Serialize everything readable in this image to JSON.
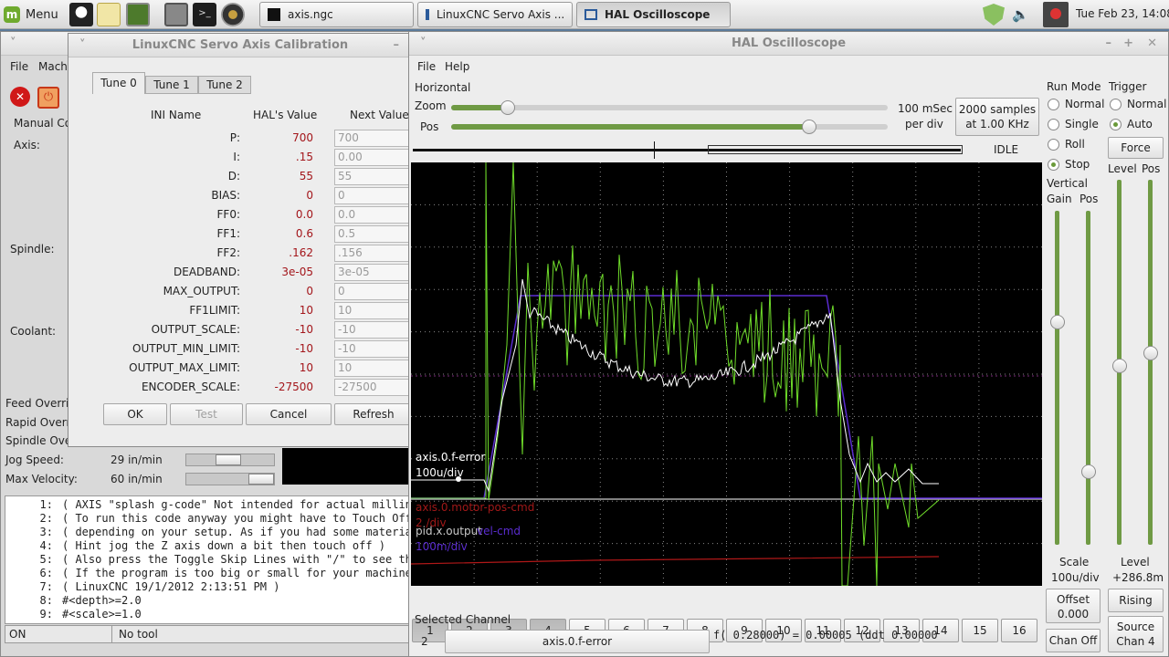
{
  "taskbar": {
    "menu_label": "Menu",
    "tasks": [
      "axis.ngc",
      "LinuxCNC Servo Axis ...",
      "HAL Oscilloscope"
    ],
    "clock": "Tue Feb 23, 14:08"
  },
  "axis": {
    "menu": [
      "File",
      "Mach"
    ],
    "tab_manual": "Manual Co",
    "axis_label": "Axis:",
    "spindle_label": "Spindle:",
    "coolant_label": "Coolant:",
    "feed_override": "Feed Overri",
    "rapid_override": "Rapid Overr",
    "spindle_override": "Spindle Ove",
    "jog_speed_label": "Jog Speed:",
    "jog_speed_value": "29 in/min",
    "max_velocity_label": "Max Velocity:",
    "max_velocity_value": "60 in/min",
    "gcode_lines": [
      {
        "n": "1:",
        "text": "( AXIS \"splash g-code\" Not intended for actual milling"
      },
      {
        "n": "2:",
        "text": "( To run this code anyway you might have to Touch Off t"
      },
      {
        "n": "3:",
        "text": "( depending on your setup. As if you had some material"
      },
      {
        "n": "4:",
        "text": "( Hint jog the Z axis down a bit then touch off )"
      },
      {
        "n": "5:",
        "text": "( Also press the Toggle Skip Lines with \"/\" to see that"
      },
      {
        "n": "6:",
        "text": "( If the program is too big or small for your machine,"
      },
      {
        "n": "7:",
        "text": "( LinuxCNC 19/1/2012 2:13:51 PM )"
      },
      {
        "n": "8:",
        "text": "#<depth>=2.0"
      },
      {
        "n": "9:",
        "text": "#<scale>=1.0"
      }
    ],
    "status_state": "ON",
    "status_tool": "No tool"
  },
  "calib": {
    "title": "LinuxCNC Servo Axis Calibration",
    "tabs": [
      "Tune 0",
      "Tune 1",
      "Tune 2"
    ],
    "col_ini": "INI Name",
    "col_hal": "HAL's Value",
    "col_next": "Next Value",
    "rows": [
      {
        "name": "P:",
        "hal": "700",
        "next": "700"
      },
      {
        "name": "I:",
        "hal": ".15",
        "next": "0.00"
      },
      {
        "name": "D:",
        "hal": "55",
        "next": "55"
      },
      {
        "name": "BIAS:",
        "hal": "0",
        "next": "0"
      },
      {
        "name": "FF0:",
        "hal": "0.0",
        "next": "0.0"
      },
      {
        "name": "FF1:",
        "hal": "0.6",
        "next": "0.5"
      },
      {
        "name": "FF2:",
        "hal": ".162",
        "next": ".156"
      },
      {
        "name": "DEADBAND:",
        "hal": "3e-05",
        "next": "3e-05"
      },
      {
        "name": "MAX_OUTPUT:",
        "hal": "0",
        "next": "0"
      },
      {
        "name": "FF1LIMIT:",
        "hal": "10",
        "next": "10"
      },
      {
        "name": "OUTPUT_SCALE:",
        "hal": "-10",
        "next": "-10"
      },
      {
        "name": "OUTPUT_MIN_LIMIT:",
        "hal": "-10",
        "next": "-10"
      },
      {
        "name": "OUTPUT_MAX_LIMIT:",
        "hal": "10",
        "next": "10"
      },
      {
        "name": "ENCODER_SCALE:",
        "hal": "-27500",
        "next": "-27500"
      }
    ],
    "buttons": [
      "OK",
      "Test",
      "Cancel",
      "Refresh"
    ]
  },
  "scope": {
    "title": "HAL Oscilloscope",
    "menu": [
      "File",
      "Help"
    ],
    "horizontal": "Horizontal",
    "zoom": "Zoom",
    "pos": "Pos",
    "zoom_level": 0.13,
    "pos_level": 0.82,
    "time_div": "100 mSec",
    "per_div": "per div",
    "samples": "2000 samples",
    "rate": "at 1.00 KHz",
    "state": "IDLE",
    "run_mode": "Run Mode",
    "run_modes": [
      "Normal",
      "Single",
      "Roll",
      "Stop"
    ],
    "run_mode_selected": "Stop",
    "trigger": "Trigger",
    "trigger_modes": [
      "Normal",
      "Auto"
    ],
    "trigger_selected": "Auto",
    "force": "Force",
    "vertical": "Vertical",
    "gain": "Gain",
    "vpos": "Pos",
    "level": "Level",
    "tpos": "Pos",
    "scale_label": "Scale",
    "scale_value": "100u/div",
    "level_label": "Level",
    "level_value": "+286.8m",
    "offset_label": "Offset",
    "offset_value": "0.000",
    "rising": "Rising",
    "chan_off": "Chan Off",
    "source_label": "Source",
    "source_value": "Chan 4",
    "trace_labels": {
      "ch1_name": "axis.0.f-error",
      "ch1_scale": "100u/div",
      "ch2_name": "axis.0.motor-pos-cmd",
      "ch2_scale": "2 /div",
      "ch3_name": "pid.x.output",
      "ch4_name": "vel-cmd",
      "ch3_scale": "100m/div"
    },
    "channels": [
      "1",
      "2",
      "3",
      "4",
      "5",
      "6",
      "7",
      "8",
      "9",
      "10",
      "11",
      "12",
      "13",
      "14",
      "15",
      "16"
    ],
    "selected_channel_label": "Selected Channel",
    "selected_channel_num": "2",
    "selected_channel_name": "axis.0.f-error",
    "readout": "f( 0.28000) =  0.00005 (ddt  0.00000"
  },
  "colors": {
    "trace_green": "#6fdc2a",
    "trace_white": "#ffffff",
    "trace_purple": "#5a2ccf",
    "trace_red": "#b01818"
  }
}
